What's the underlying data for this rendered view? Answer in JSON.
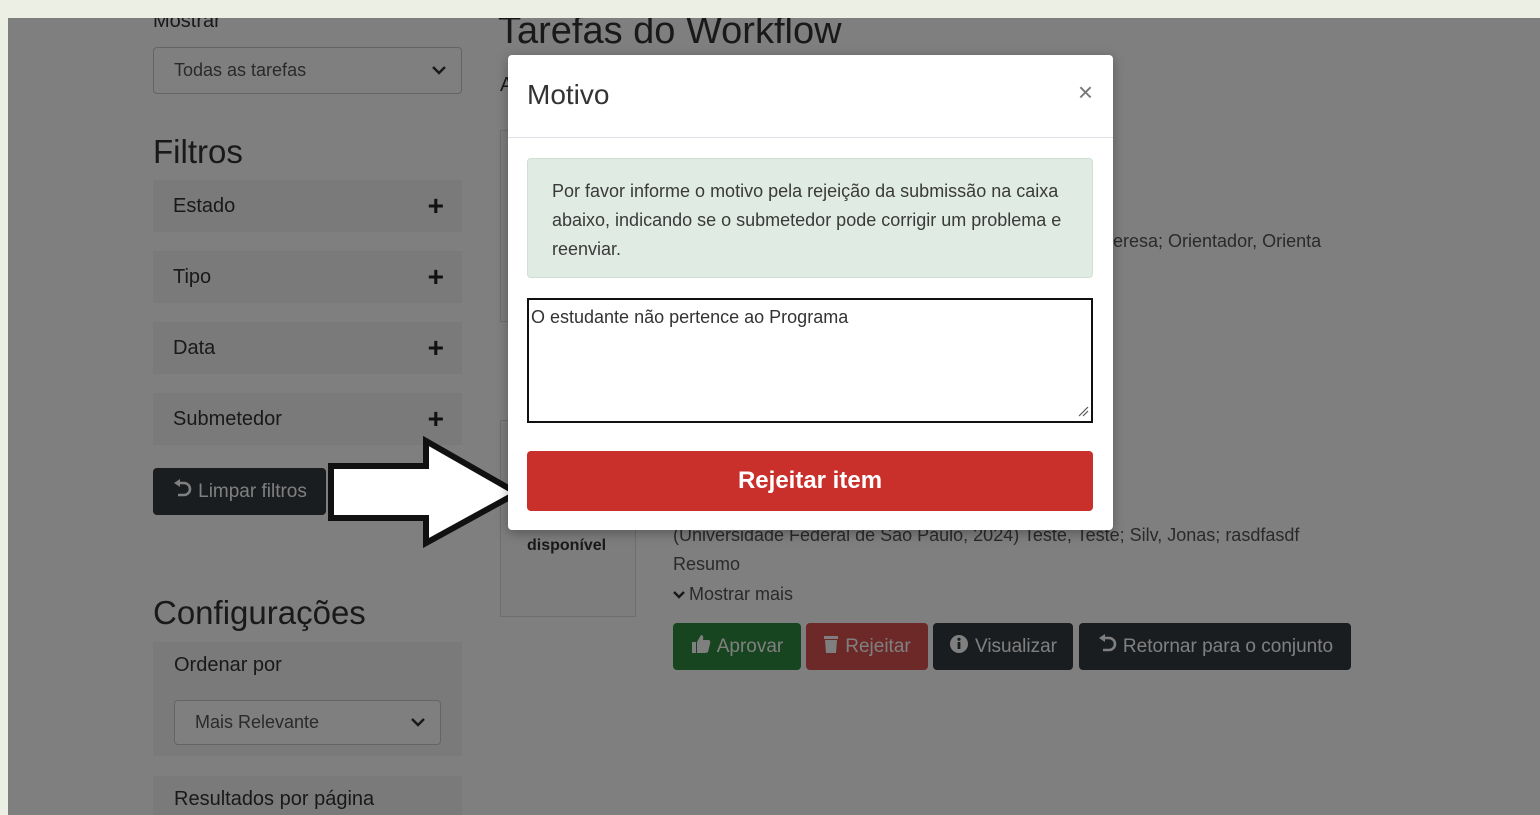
{
  "sidebar": {
    "show_label": "Mostrar",
    "show_select_value": "Todas as tarefas",
    "filters_heading": "Filtros",
    "filters": [
      {
        "label": "Estado"
      },
      {
        "label": "Tipo"
      },
      {
        "label": "Data"
      },
      {
        "label": "Submetedor"
      }
    ],
    "clear_filters_label": "Limpar filtros",
    "settings_heading": "Configurações",
    "order_by_label": "Ordenar por",
    "order_by_value": "Mais Relevante",
    "results_per_page_label": "Resultados por página"
  },
  "main": {
    "title": "Tarefas do Workflow",
    "partial_a": "A",
    "authors_fragment": "eresa; Orientador, Orienta",
    "item": {
      "thumb_text": "disponível",
      "citation": "(Universidade Federal de São Paulo, 2024) Teste, Teste; Silv, Jonas; rasdfasdf",
      "abstract_label": "Resumo",
      "show_more": "Mostrar mais"
    },
    "actions": {
      "approve": "Aprovar",
      "reject": "Rejeitar",
      "view": "Visualizar",
      "return": "Retornar para o conjunto"
    }
  },
  "modal": {
    "title": "Motivo",
    "close": "×",
    "info_text": "Por favor informe o motivo pela rejeição da submissão na caixa abaixo, indicando se o submetedor pode corrigir um problema e reenviar.",
    "reason_value": "O estudante não pertence ao Programa",
    "reject_button": "Rejeitar item"
  },
  "colors": {
    "reject_button": "#c9302c",
    "approve": "#2e8b3f",
    "reject": "#d9534f",
    "dark": "#343a40",
    "alert_bg": "#dfebe3"
  }
}
